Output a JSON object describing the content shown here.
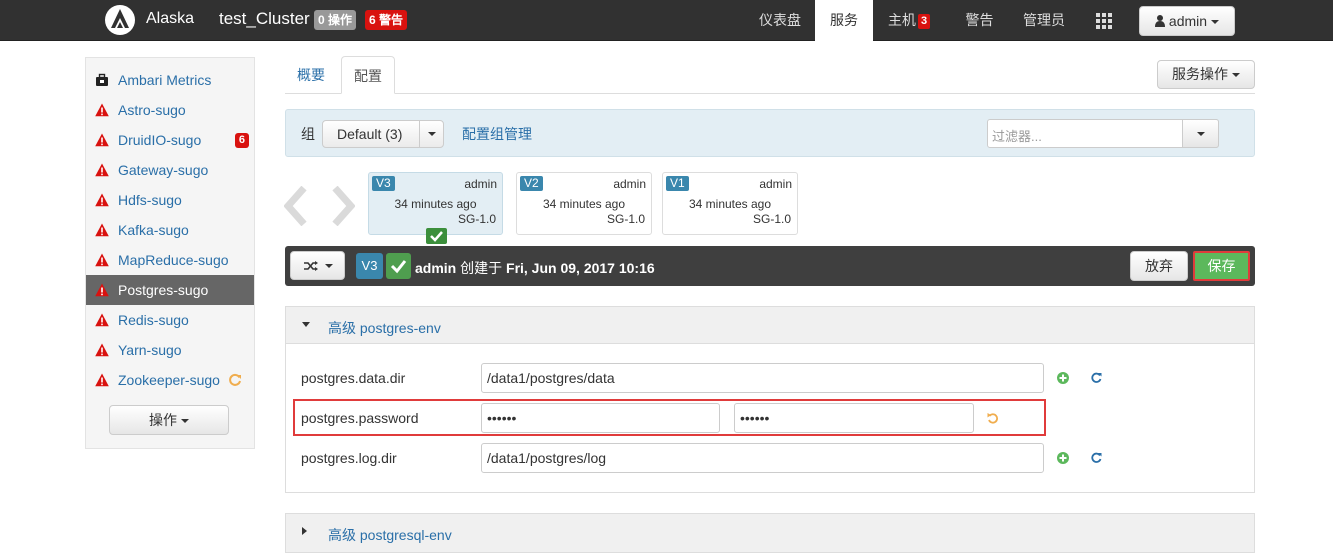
{
  "topbar": {
    "brand": "Alaska",
    "cluster": "test_Cluster",
    "ops_badge": "0 操作",
    "alerts_badge": "6 警告",
    "nav": {
      "dashboard": "仪表盘",
      "services": "服务",
      "hosts": "主机",
      "hosts_badge": "3",
      "alerts": "警告",
      "admin": "管理员"
    },
    "user": "admin"
  },
  "sidebar": {
    "items": [
      {
        "label": "Ambari Metrics",
        "icon": "briefcase-icon"
      },
      {
        "label": "Astro-sugo",
        "icon": "warning-icon"
      },
      {
        "label": "DruidIO-sugo",
        "icon": "warning-icon",
        "badge": "6"
      },
      {
        "label": "Gateway-sugo",
        "icon": "warning-icon"
      },
      {
        "label": "Hdfs-sugo",
        "icon": "warning-icon"
      },
      {
        "label": "Kafka-sugo",
        "icon": "warning-icon"
      },
      {
        "label": "MapReduce-sugo",
        "icon": "warning-icon"
      },
      {
        "label": "Postgres-sugo",
        "icon": "warning-icon",
        "active": true
      },
      {
        "label": "Redis-sugo",
        "icon": "warning-icon"
      },
      {
        "label": "Yarn-sugo",
        "icon": "warning-icon"
      },
      {
        "label": "Zookeeper-sugo",
        "icon": "warning-icon",
        "extra_icon": "refresh-icon"
      }
    ],
    "actions_label": "操作"
  },
  "tabs": {
    "summary": "概要",
    "config": "配置"
  },
  "service_actions": "服务操作",
  "group_bar": {
    "label": "组",
    "selected_group": "Default (3)",
    "manage_link": "配置组管理",
    "filter_placeholder": "过滤器..."
  },
  "versions": [
    {
      "tag": "V3",
      "user": "admin",
      "time": "34 minutes ago",
      "stack": "SG-1.0",
      "current": true
    },
    {
      "tag": "V2",
      "user": "admin",
      "time": "34 minutes ago",
      "stack": "SG-1.0"
    },
    {
      "tag": "V1",
      "user": "admin",
      "time": "34 minutes ago",
      "stack": "SG-1.0"
    }
  ],
  "current_bar": {
    "version_tag": "V3",
    "user": "admin",
    "created_text": "创建于",
    "date": "Fri, Jun 09, 2017 10:16",
    "discard": "放弃",
    "save": "保存"
  },
  "panels": {
    "env": {
      "title": "高级 postgres-env",
      "props": [
        {
          "name": "postgres.data.dir",
          "value": "/data1/postgres/data"
        },
        {
          "name": "postgres.password",
          "value": "••••••",
          "confirm": "••••••"
        },
        {
          "name": "postgres.log.dir",
          "value": "/data1/postgres/log"
        }
      ]
    },
    "sql_env": {
      "title": "高级 postgresql-env"
    }
  },
  "colors": {
    "link": "#2a6fa8",
    "danger": "#d9120f",
    "success": "#5cb85c",
    "info": "#3a87ad"
  }
}
